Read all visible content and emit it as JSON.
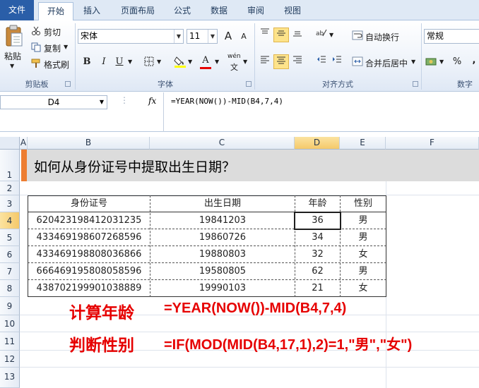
{
  "tabs": {
    "file": "文件",
    "home": "开始",
    "insert": "插入",
    "page_layout": "页面布局",
    "formulas": "公式",
    "data": "数据",
    "review": "审阅",
    "view": "视图"
  },
  "ribbon": {
    "clipboard": {
      "paste": "粘贴",
      "cut": "剪切",
      "copy": "复制",
      "format_painter": "格式刷",
      "label": "剪贴板"
    },
    "font": {
      "name": "宋体",
      "size": "11",
      "bold": "B",
      "italic": "I",
      "underline": "U",
      "label": "字体",
      "grow": "A",
      "shrink": "A",
      "font_color": "A",
      "phonetic": "wén"
    },
    "alignment": {
      "wrap": "自动换行",
      "merge": "合并后居中",
      "label": "对齐方式"
    },
    "number": {
      "format": "常规",
      "percent": "%",
      "comma": ",",
      "label": "数字"
    }
  },
  "formula_bar": {
    "name_box": "D4",
    "fx": "fx",
    "formula": "=YEAR(NOW())-MID(B4,7,4)"
  },
  "columns": [
    "A",
    "B",
    "C",
    "D",
    "E",
    "F"
  ],
  "rows": [
    "1",
    "2",
    "3",
    "4",
    "5",
    "6",
    "7",
    "8",
    "9",
    "10",
    "11",
    "12",
    "13"
  ],
  "sheet": {
    "title": "如何从身份证号中提取出生日期？",
    "table": {
      "headers": [
        "身份证号",
        "出生日期",
        "年龄",
        "性别"
      ],
      "rows": [
        [
          "620423198412031235",
          "19841203",
          "36",
          "男"
        ],
        [
          "433469198607268596",
          "19860726",
          "34",
          "男"
        ],
        [
          "433469198808036866",
          "19880803",
          "32",
          "女"
        ],
        [
          "666469195808058596",
          "19580805",
          "62",
          "男"
        ],
        [
          "438702199901038889",
          "19990103",
          "21",
          "女"
        ]
      ]
    },
    "notes": [
      {
        "label": "计算年龄",
        "formula": "=YEAR(NOW())-MID(B4,7,4)"
      },
      {
        "label": "判断性别",
        "formula": "=IF(MOD(MID(B4,17,1),2)=1,\"男\",\"女\")"
      }
    ]
  },
  "colors": {
    "accent": "#ed7d31",
    "note": "#e60000",
    "file_tab": "#2a5ea8"
  }
}
